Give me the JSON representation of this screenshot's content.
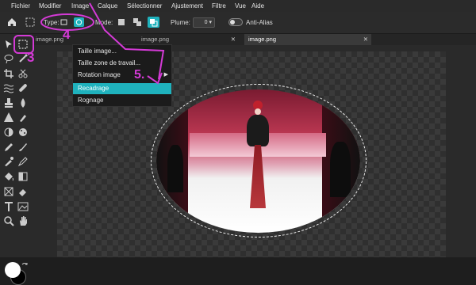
{
  "menu": [
    "Fichier",
    "Modifier",
    "Image",
    "Calque",
    "Sélectionner",
    "Ajustement",
    "Filtre",
    "Vue",
    "Aide"
  ],
  "options": {
    "type_label": "Type:",
    "mode_label": "Mode:",
    "plume_label": "Plume:",
    "plume_value": "0",
    "antialias_label": "Anti-Alias"
  },
  "tabs": [
    "image.png",
    "image.png",
    "image.png"
  ],
  "dropdown": [
    "Taille image...",
    "Taille zone de travail...",
    "Rotation image",
    "Recadrage",
    "Rognage"
  ],
  "annotations": {
    "a3": "3",
    "a4": "4",
    "a5": "5."
  },
  "colors": {
    "accent": "#1fb2bd",
    "annotation": "#d43ad6"
  }
}
